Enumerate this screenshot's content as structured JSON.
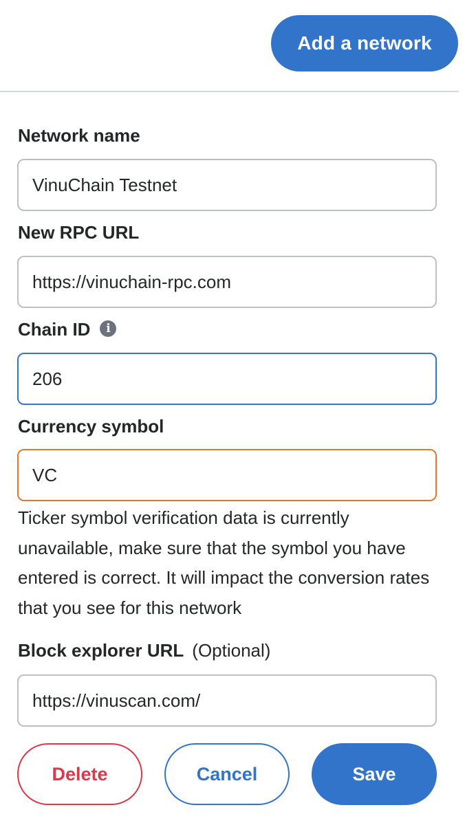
{
  "header": {
    "add_network_label": "Add a network"
  },
  "form": {
    "network_name": {
      "label": "Network name",
      "value": "VinuChain Testnet"
    },
    "rpc_url": {
      "label": "New RPC URL",
      "value": "https://vinuchain-rpc.com"
    },
    "chain_id": {
      "label": "Chain ID",
      "info_icon": "i",
      "value": "206"
    },
    "currency_symbol": {
      "label": "Currency symbol",
      "value": "VC",
      "warning": "Ticker symbol verification data is currently unavailable, make sure that the symbol you have entered is correct. It will impact the conversion rates that you see for this network"
    },
    "block_explorer": {
      "label": "Block explorer URL",
      "optional": "(Optional)",
      "value": "https://vinuscan.com/"
    }
  },
  "actions": {
    "delete_label": "Delete",
    "cancel_label": "Cancel",
    "save_label": "Save"
  },
  "colors": {
    "primary": "#3174c9",
    "danger": "#d73a49",
    "warning": "#e2792e",
    "border": "#bbc0c5"
  },
  "icons": {
    "chain_id_info": "info-icon"
  }
}
